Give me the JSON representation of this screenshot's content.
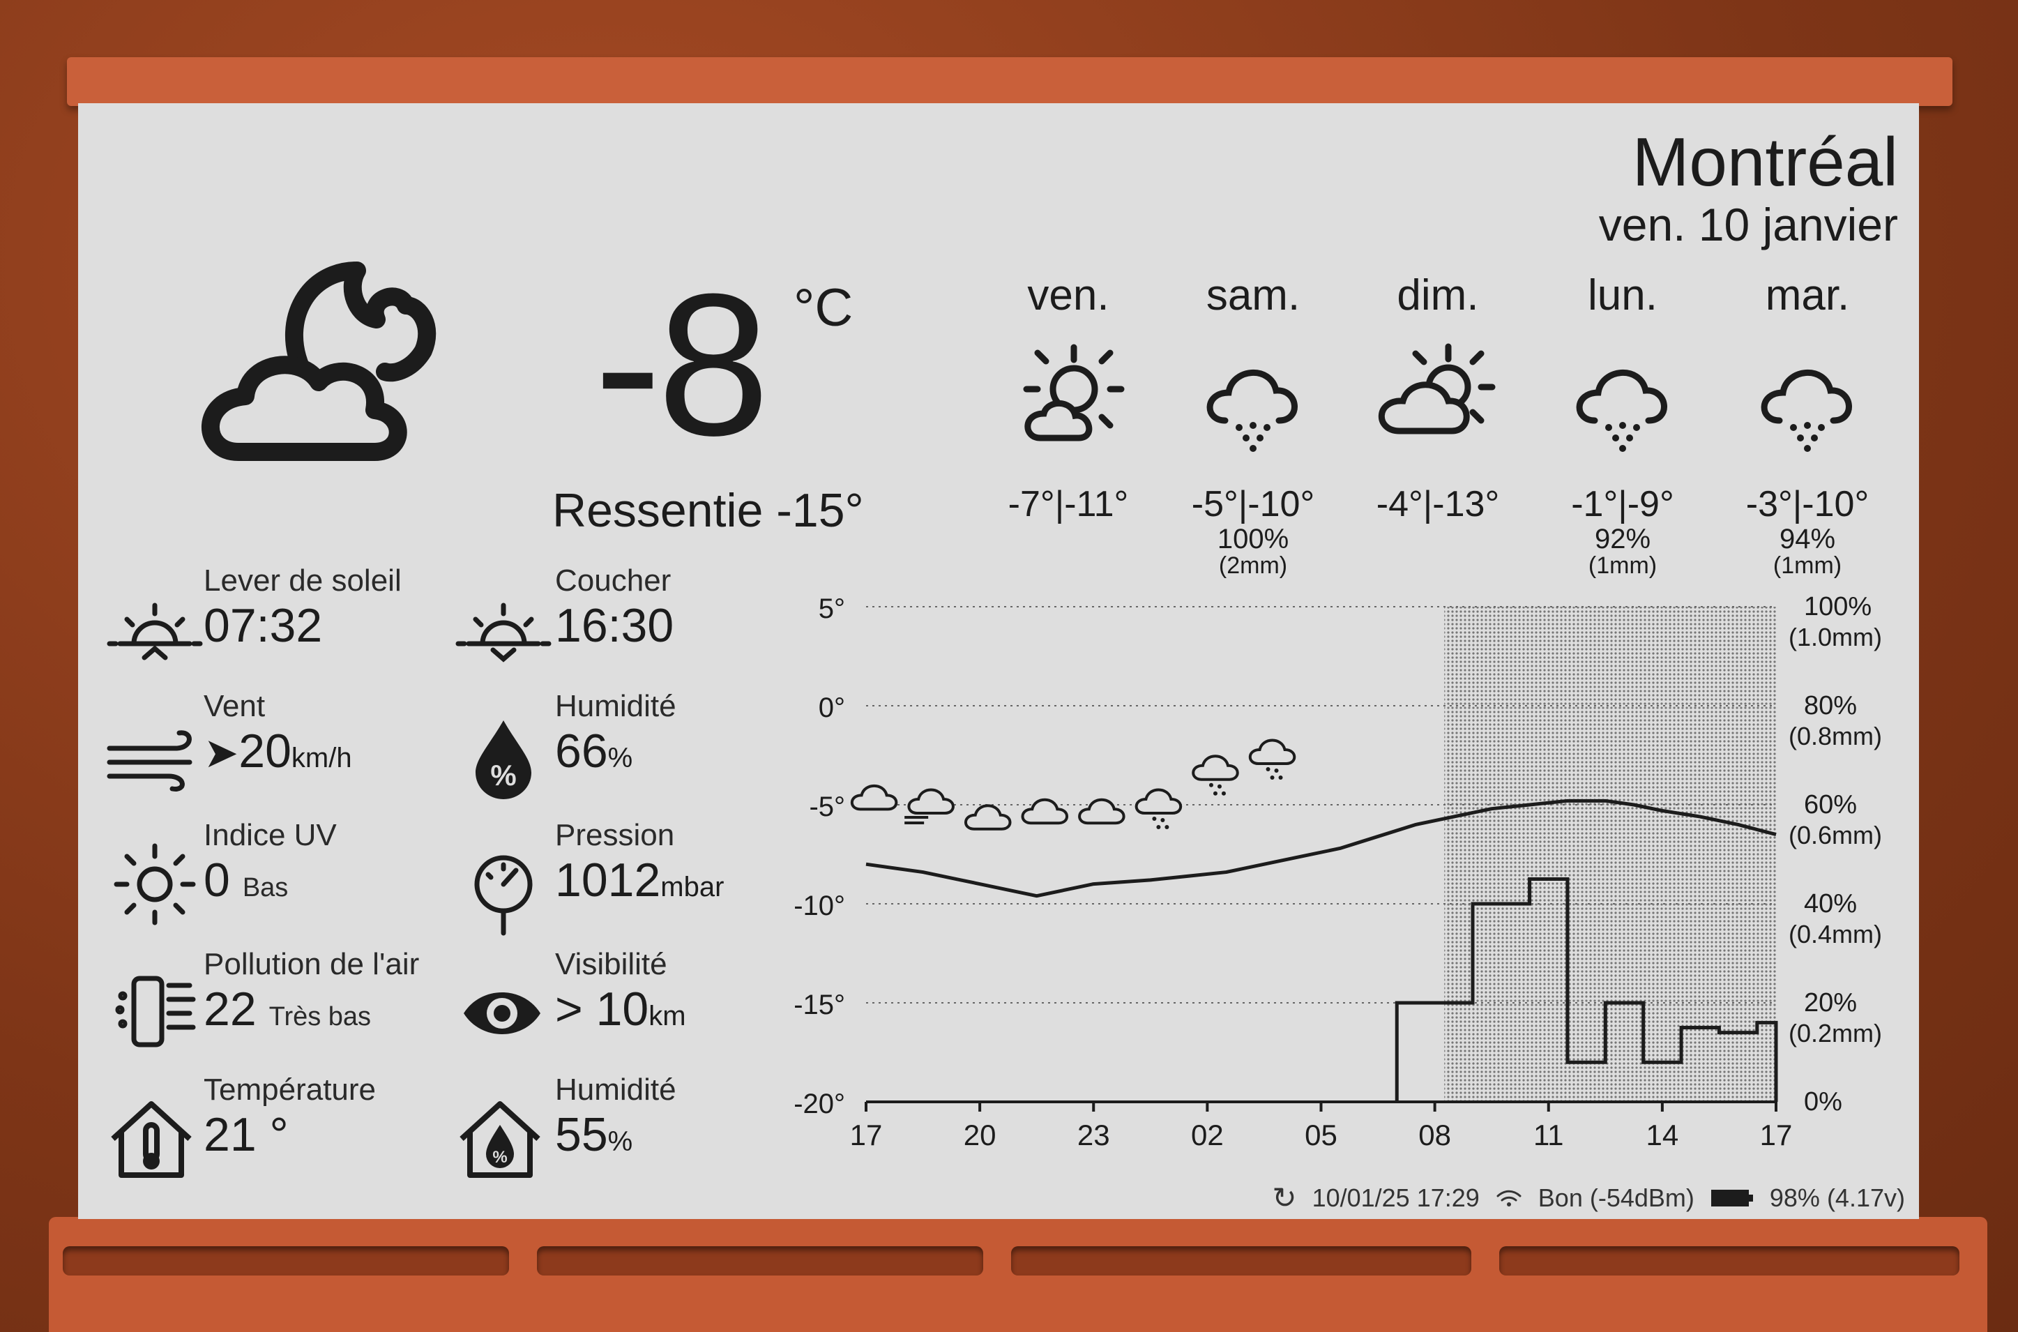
{
  "header": {
    "city": "Montréal",
    "date": "ven. 10 janvier"
  },
  "current": {
    "temp": "-8",
    "unit": "°C",
    "feels_like": "Ressentie -15°",
    "icon": "cloud-moon-icon"
  },
  "forecast": [
    {
      "day": "ven.",
      "hilo": "-7°|-11°",
      "icon": "partly-sunny-icon"
    },
    {
      "day": "sam.",
      "hilo": "-5°|-10°",
      "precip": "100%",
      "amount": "(2mm)",
      "icon": "snow-cloud-icon"
    },
    {
      "day": "dim.",
      "hilo": "-4°|-13°",
      "icon": "partly-sunny-icon"
    },
    {
      "day": "lun.",
      "hilo": "-1°|-9°",
      "precip": "92%",
      "amount": "(1mm)",
      "icon": "snow-cloud-icon"
    },
    {
      "day": "mar.",
      "hilo": "-3°|-10°",
      "precip": "94%",
      "amount": "(1mm)",
      "icon": "snow-cloud-icon"
    }
  ],
  "stats": {
    "sunrise": {
      "label": "Lever de soleil",
      "value": "07:32"
    },
    "sunset": {
      "label": "Coucher",
      "value": "16:30"
    },
    "wind": {
      "label": "Vent",
      "value": "20",
      "unit": "km/h"
    },
    "humidity": {
      "label": "Humidité",
      "value": "66",
      "unit": "%"
    },
    "uv": {
      "label": "Indice UV",
      "value": "0",
      "sub": "Bas"
    },
    "pressure": {
      "label": "Pression",
      "value": "1012",
      "unit": "mbar"
    },
    "air": {
      "label": "Pollution de l'air",
      "value": "22",
      "sub": "Très bas"
    },
    "visibility": {
      "label": "Visibilité",
      "value": "> 10",
      "unit": "km"
    },
    "indoor_temp": {
      "label": "Température",
      "value": "21 °"
    },
    "indoor_humidity": {
      "label": "Humidité",
      "value": "55",
      "unit": "%"
    }
  },
  "status": {
    "updated": "10/01/25 17:29",
    "wifi": "Bon (-54dBm)",
    "battery": "98% (4.17v)"
  },
  "chart_data": {
    "type": "line",
    "x": [
      0,
      3,
      6,
      9,
      12,
      15,
      18,
      21,
      24,
      27,
      30,
      33,
      36,
      39,
      42,
      45,
      48
    ],
    "x_ticks": [
      "17",
      "20",
      "23",
      "02",
      "05",
      "08",
      "11",
      "14",
      "17"
    ],
    "ylim": [
      -20,
      5
    ],
    "y_ticks": [
      "5°",
      "0°",
      "-5°",
      "-10°",
      "-15°",
      "-20°"
    ],
    "y2_ticks": [
      {
        "pct": "100%",
        "mm": "(1.0mm)"
      },
      {
        "pct": "80%",
        "mm": "(0.8mm)"
      },
      {
        "pct": "60%",
        "mm": "(0.6mm)"
      },
      {
        "pct": "40%",
        "mm": "(0.4mm)"
      },
      {
        "pct": "20%",
        "mm": "(0.2mm)"
      },
      {
        "pct": "0%",
        "mm": ""
      }
    ],
    "temperature": {
      "x": [
        0,
        3,
        5,
        7,
        9,
        12,
        15,
        17,
        19,
        21,
        23,
        25,
        27,
        29,
        31,
        33,
        35,
        37,
        39,
        40.5,
        42,
        44,
        46,
        48
      ],
      "y": [
        -8.0,
        -8.4,
        -8.8,
        -9.2,
        -9.6,
        -9.0,
        -8.8,
        -8.6,
        -8.4,
        -8.0,
        -7.6,
        -7.2,
        -6.6,
        -6.0,
        -5.6,
        -5.2,
        -5.0,
        -4.8,
        -4.8,
        -5.0,
        -5.3,
        -5.6,
        -6.0,
        -6.5
      ]
    },
    "precip_shade": {
      "x_start": 30.5,
      "x_end": 48
    },
    "precip_prob": {
      "x": [
        28,
        29,
        30,
        31,
        32,
        33,
        34,
        35,
        36,
        37,
        38,
        39,
        40,
        41,
        42,
        43,
        44,
        45,
        46,
        47,
        48
      ],
      "pct": [
        20,
        20,
        20,
        20,
        40,
        40,
        40,
        45,
        45,
        8,
        8,
        20,
        20,
        8,
        8,
        15,
        15,
        14,
        14,
        16,
        16
      ]
    },
    "hourly_icons": [
      {
        "x": 0.5,
        "temp": -4.8,
        "icon": "partly-cloudy-night-icon"
      },
      {
        "x": 3.5,
        "temp": -5.0,
        "icon": "cloud-wind-icon"
      },
      {
        "x": 6.5,
        "temp": -5.8,
        "icon": "cloud-icon"
      },
      {
        "x": 9.5,
        "temp": -5.5,
        "icon": "cloud-icon"
      },
      {
        "x": 12.5,
        "temp": -5.5,
        "icon": "cloud-icon"
      },
      {
        "x": 15.5,
        "temp": -5.0,
        "icon": "snow-cloud-icon"
      },
      {
        "x": 18.5,
        "temp": -3.3,
        "icon": "snow-cloud-icon"
      },
      {
        "x": 21.5,
        "temp": -2.5,
        "icon": "snow-cloud-icon"
      }
    ]
  }
}
